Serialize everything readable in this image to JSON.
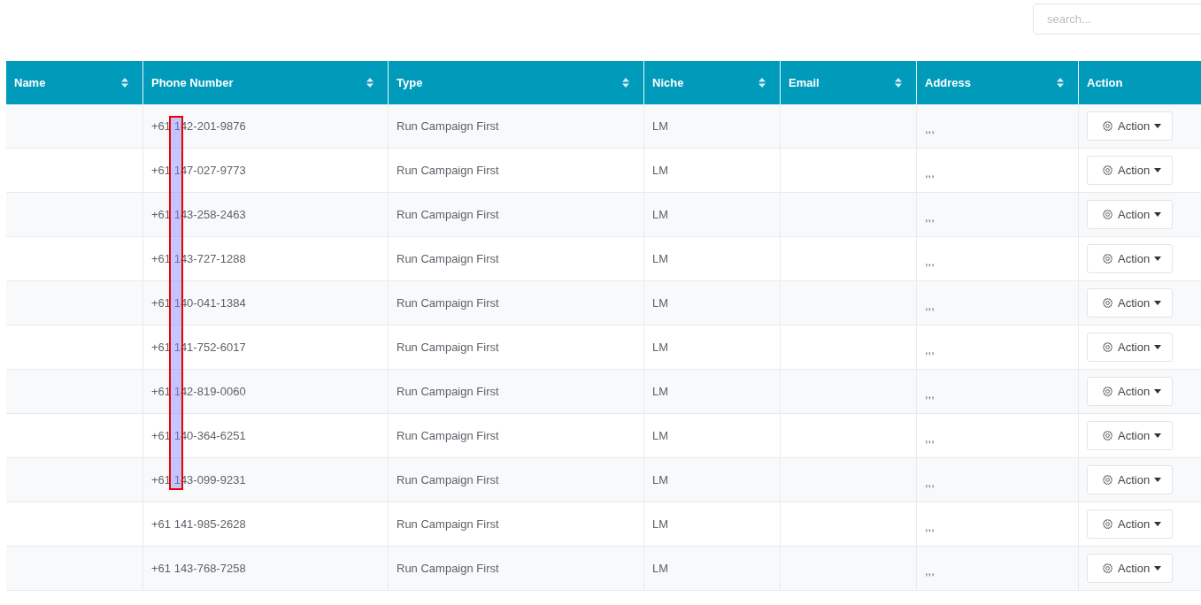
{
  "search": {
    "placeholder": "search..."
  },
  "table": {
    "columns": [
      {
        "label": "Name",
        "sortable": true
      },
      {
        "label": "Phone Number",
        "sortable": true
      },
      {
        "label": "Type",
        "sortable": true
      },
      {
        "label": "Niche",
        "sortable": true
      },
      {
        "label": "Email",
        "sortable": true
      },
      {
        "label": "Address",
        "sortable": true
      },
      {
        "label": "Action",
        "sortable": false
      }
    ],
    "rows": [
      {
        "phone": "+61 142-201-9876",
        "type": "Run Campaign First",
        "niche": "LM",
        "address": ",,,",
        "action": "Action"
      },
      {
        "phone": "+61 147-027-9773",
        "type": "Run Campaign First",
        "niche": "LM",
        "address": ",,,",
        "action": "Action"
      },
      {
        "phone": "+61 143-258-2463",
        "type": "Run Campaign First",
        "niche": "LM",
        "address": ",,,",
        "action": "Action"
      },
      {
        "phone": "+61 143-727-1288",
        "type": "Run Campaign First",
        "niche": "LM",
        "address": ",,,",
        "action": "Action"
      },
      {
        "phone": "+61 140-041-1384",
        "type": "Run Campaign First",
        "niche": "LM",
        "address": ",,,",
        "action": "Action"
      },
      {
        "phone": "+61 141-752-6017",
        "type": "Run Campaign First",
        "niche": "LM",
        "address": ",,,",
        "action": "Action"
      },
      {
        "phone": "+61 142-819-0060",
        "type": "Run Campaign First",
        "niche": "LM",
        "address": ",,,",
        "action": "Action"
      },
      {
        "phone": "+61 140-364-6251",
        "type": "Run Campaign First",
        "niche": "LM",
        "address": ",,,",
        "action": "Action"
      },
      {
        "phone": "+61 143-099-9231",
        "type": "Run Campaign First",
        "niche": "LM",
        "address": ",,,",
        "action": "Action"
      },
      {
        "phone": "+61 141-985-2628",
        "type": "Run Campaign First",
        "niche": "LM",
        "address": ",,,",
        "action": "Action"
      },
      {
        "phone": "+61 143-768-7258",
        "type": "Run Campaign First",
        "niche": "LM",
        "address": ",,,",
        "action": "Action"
      }
    ]
  }
}
